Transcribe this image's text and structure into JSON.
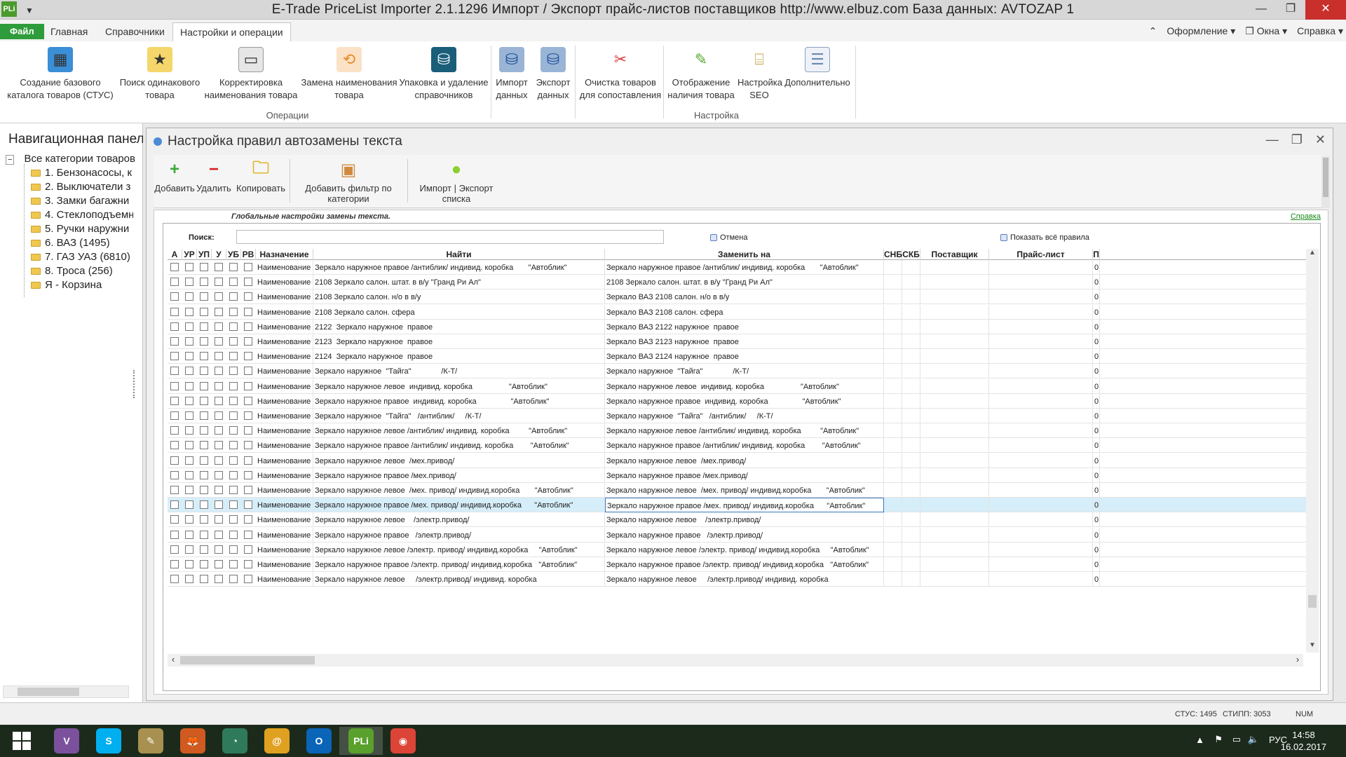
{
  "window": {
    "app_icon": "PLi",
    "title": "E-Trade PriceList Importer 2.1.1296     Импорт / Экспорт прайс-листов поставщиков     http://www.elbuz.com     База данных: AVTOZAP 1"
  },
  "ribbon_tabs": [
    {
      "label": "Файл"
    },
    {
      "label": "Главная"
    },
    {
      "label": "Справочники"
    },
    {
      "label": "Настройки и операции"
    }
  ],
  "ribbon_right": {
    "design": "Оформление",
    "windows": "Окна",
    "help": "Справка"
  },
  "ribbon_buttons": [
    {
      "label": "Создание базового\nкаталога товаров (СТУС)",
      "icon": "cubes-icon",
      "color": "#3a8fd6"
    },
    {
      "label": "Поиск одинакового\nтовара",
      "icon": "star-folder-icon",
      "color": "#f0c030"
    },
    {
      "label": "Корректировка\nнаименования товара",
      "icon": "edit-document-icon",
      "color": "#888888"
    },
    {
      "label": "Замена наименования\nтовара",
      "icon": "replace-icon",
      "color": "#e88a2a"
    },
    {
      "label": "Упаковка и удаление\nсправочников",
      "icon": "database-icon",
      "color": "#1a5e7a"
    },
    {
      "label": "Импорт\nданных",
      "icon": "db-import-icon",
      "color": "#3a7ed6"
    },
    {
      "label": "Экспорт\nданных",
      "icon": "db-export-icon",
      "color": "#3a7ed6"
    },
    {
      "label": "Очистка товаров\nдля сопоставления",
      "icon": "clean-tools-icon",
      "color": "#d63a3a"
    },
    {
      "label": "Отображение\nналичия товара",
      "icon": "pencil-icon",
      "color": "#58a830"
    },
    {
      "label": "Настройка\nSEO",
      "icon": "seo-icon",
      "color": "#c0a040"
    },
    {
      "label": "Дополнительно",
      "icon": "document-icon",
      "color": "#6a8ab0"
    }
  ],
  "ribbon_groups": {
    "operations": "Операции",
    "settings": "Настройка"
  },
  "nav": {
    "title": "Навигационная панель",
    "root": "Все категории товаров",
    "items": [
      "1. Бензонасосы, к",
      "2. Выключатели з",
      "3. Замки багажни",
      "4. Стеклоподъемн",
      "5. Ручки наружни",
      "6. ВАЗ (1495)",
      "7. ГАЗ УАЗ (6810)",
      "8. Троса (256)",
      "Я - Корзина"
    ]
  },
  "doc": {
    "title": "Настройка правил автозамены текста",
    "toolbar": [
      {
        "label": "Добавить",
        "icon": "plus-icon",
        "color": "#3aaa3a"
      },
      {
        "label": "Удалить",
        "icon": "minus-icon",
        "color": "#d62020"
      },
      {
        "label": "Копировать",
        "icon": "copy-folder-icon",
        "color": "#f0c030"
      },
      {
        "label": "Добавить фильтр по категории",
        "icon": "box-add-icon",
        "color": "#d08a40"
      },
      {
        "label": "Импорт | Экспорт списка",
        "icon": "import-export-icon",
        "color": "#8ccf30"
      }
    ],
    "global_label": "Глобальные настройки замены текста.",
    "help_link": "Справка",
    "search_label": "Поиск:",
    "search_value": "",
    "cancel_label": "Отмена",
    "show_all_label": "Показать всё правила"
  },
  "table": {
    "columns": [
      "А",
      "УР",
      "УП",
      "У",
      "УБ",
      "РВ",
      "Назначение",
      "Найти",
      "Заменить на",
      "СНБ",
      "СКБ",
      "Поставщик",
      "Прайс-лист",
      "П"
    ],
    "rows": [
      {
        "type": "Наименование",
        "find": "Зеркало наружное правое /антиблик/ индивид. коробка       \"Автоблик\"",
        "replace": "Зеркало наружное правое /антиблик/ индивид. коробка       \"Автоблик\"",
        "p": "0"
      },
      {
        "type": "Наименование",
        "find": "2108 Зеркало салон. штат. в в/у \"Гранд Ри Ал\"",
        "replace": "2108 Зеркало салон. штат. в в/у \"Гранд Ри Ал\"",
        "p": "0"
      },
      {
        "type": "Наименование",
        "find": "2108 Зеркало салон. н/о в в/у",
        "replace": "Зеркало ВАЗ 2108 салон. н/о в в/у",
        "p": "0"
      },
      {
        "type": "Наименование",
        "find": "2108 Зеркало салон. сфера",
        "replace": "Зеркало ВАЗ 2108 салон. сфера",
        "p": "0"
      },
      {
        "type": "Наименование",
        "find": "2122  Зеркало наружное  правое",
        "replace": "Зеркало ВАЗ 2122 наружное  правое",
        "p": "0"
      },
      {
        "type": "Наименование",
        "find": "2123  Зеркало наружное  правое",
        "replace": "Зеркало ВАЗ 2123 наружное  правое",
        "p": "0"
      },
      {
        "type": "Наименование",
        "find": "2124  Зеркало наружное  правое",
        "replace": "Зеркало ВАЗ 2124 наружное  правое",
        "p": "0"
      },
      {
        "type": "Наименование",
        "find": "Зеркало наружное  \"Тайга\"              /К-Т/",
        "replace": "Зеркало наружное  \"Тайга\"              /К-Т/",
        "p": "0"
      },
      {
        "type": "Наименование",
        "find": "Зеркало наружное левое  индивид. коробка                 \"Автоблик\"",
        "replace": "Зеркало наружное левое  индивид. коробка                 \"Автоблик\"",
        "p": "0"
      },
      {
        "type": "Наименование",
        "find": "Зеркало наружное правое  индивид. коробка                \"Автоблик\"",
        "replace": "Зеркало наружное правое  индивид. коробка                \"Автоблик\"",
        "p": "0"
      },
      {
        "type": "Наименование",
        "find": "Зеркало наружное  \"Тайга\"   /антиблик/     /К-Т/",
        "replace": "Зеркало наружное  \"Тайга\"   /антиблик/     /К-Т/",
        "p": "0"
      },
      {
        "type": "Наименование",
        "find": "Зеркало наружное левое /антиблик/ индивид. коробка         \"Автоблик\"",
        "replace": "Зеркало наружное левое /антиблик/ индивид. коробка         \"Автоблик\"",
        "p": "0"
      },
      {
        "type": "Наименование",
        "find": "Зеркало наружное правое /антиблик/ индивид. коробка        \"Автоблик\"",
        "replace": "Зеркало наружное правое /антиблик/ индивид. коробка        \"Автоблик\"",
        "p": "0"
      },
      {
        "type": "Наименование",
        "find": "Зеркало наружное левое  /мех.привод/",
        "replace": "Зеркало наружное левое  /мех.привод/",
        "p": "0"
      },
      {
        "type": "Наименование",
        "find": "Зеркало наружное правое /мех.привод/",
        "replace": "Зеркало наружное правое /мех.привод/",
        "p": "0"
      },
      {
        "type": "Наименование",
        "find": "Зеркало наружное левое  /мех. привод/ индивид.коробка       \"Автоблик\"",
        "replace": "Зеркало наружное левое  /мех. привод/ индивид.коробка       \"Автоблик\"",
        "p": "0"
      },
      {
        "type": "Наименование",
        "find": "Зеркало наружное правое /мех. привод/ индивид.коробка      \"Автоблик\"",
        "replace": "Зеркало наружное правое /мех. привод/ индивид.коробка      \"Автоблик\"",
        "p": "0",
        "selected": true
      },
      {
        "type": "Наименование",
        "find": "Зеркало наружное левое    /электр.привод/",
        "replace": "Зеркало наружное левое    /электр.привод/",
        "p": "0"
      },
      {
        "type": "Наименование",
        "find": "Зеркало наружное правое   /электр.привод/",
        "replace": "Зеркало наружное правое   /электр.привод/",
        "p": "0"
      },
      {
        "type": "Наименование",
        "find": "Зеркало наружное левое /электр. привод/ индивид.коробка     \"Автоблик\"",
        "replace": "Зеркало наружное левое /электр. привод/ индивид.коробка     \"Автоблик\"",
        "p": "0"
      },
      {
        "type": "Наименование",
        "find": "Зеркало наружное правое /электр. привод/ индивид.коробка   \"Автоблик\"",
        "replace": "Зеркало наружное правое /электр. привод/ индивид.коробка   \"Автоблик\"",
        "p": "0"
      },
      {
        "type": "Наименование",
        "find": "Зеркало наружное левое     /электр.привод/ индивид. коробка",
        "replace": "Зеркало наружное левое     /электр.привод/ индивид. коробка",
        "p": "0"
      }
    ]
  },
  "status": {
    "stus": "СТУС: 1495",
    "stipp": "СТИПП: 3053",
    "num": "NUM"
  },
  "taskbar": {
    "apps": [
      {
        "name": "windows-start-icon",
        "label": "",
        "color": "#1c2a1c"
      },
      {
        "name": "viber-icon",
        "label": "V",
        "color": "#7b519d"
      },
      {
        "name": "skype-icon",
        "label": "S",
        "color": "#00aff0"
      },
      {
        "name": "notes-app-icon",
        "label": "✎",
        "color": "#a89050"
      },
      {
        "name": "fox-app-icon",
        "label": "🦊",
        "color": "#d05a20"
      },
      {
        "name": "chart-app-icon",
        "label": "◔",
        "color": "#2f7a5a"
      },
      {
        "name": "mail-app-icon",
        "label": "@",
        "color": "#e0a020"
      },
      {
        "name": "outlook-icon",
        "label": "O",
        "color": "#0a64b8"
      },
      {
        "name": "pli-app-icon",
        "label": "PLi",
        "color": "#5aa02c"
      },
      {
        "name": "chrome-icon",
        "label": "◉",
        "color": "#db4437"
      }
    ],
    "lang": "РУС",
    "time": "14:58",
    "date": "16.02.2017"
  }
}
